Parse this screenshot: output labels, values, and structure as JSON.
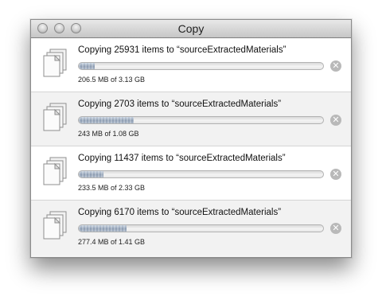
{
  "window": {
    "title": "Copy"
  },
  "title_buttons": {
    "close": "close",
    "minimize": "minimize",
    "zoom": "zoom"
  },
  "accent_colors": {
    "progress_fill": "#8d9db2",
    "stop_button": "#b9b9b9"
  },
  "stop_icon_glyph": "✕",
  "items": [
    {
      "title": "Copying 25931 items to “sourceExtractedMaterials”",
      "status": "206.5 MB of 3.13 GB",
      "progress_fraction": 0.066
    },
    {
      "title": "Copying 2703 items to “sourceExtractedMaterials”",
      "status": "243 MB of 1.08 GB",
      "progress_fraction": 0.225
    },
    {
      "title": "Copying 11437 items to “sourceExtractedMaterials”",
      "status": "233.5 MB of 2.33 GB",
      "progress_fraction": 0.1
    },
    {
      "title": "Copying 6170 items to “sourceExtractedMaterials”",
      "status": "277.4 MB of 1.41 GB",
      "progress_fraction": 0.197
    }
  ]
}
